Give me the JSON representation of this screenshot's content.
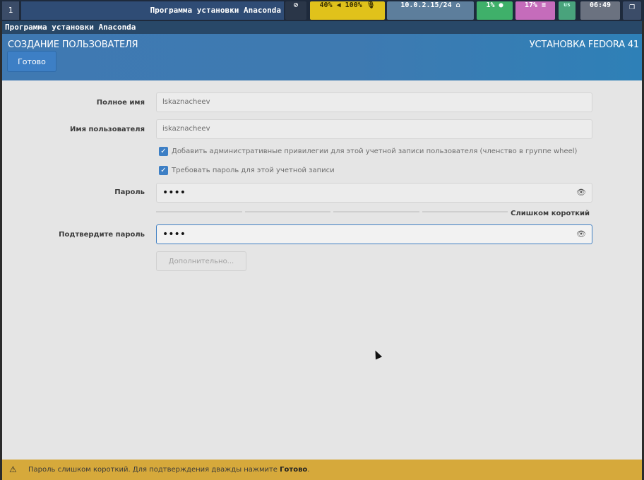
{
  "statusbar": {
    "workspace": "1",
    "window_title": "Программа установки Anaconda",
    "eye_icon": "eye-off-icon",
    "volume": "40% ◀ 100% 🎙",
    "network": "10.0.2.15/24 ⌂",
    "cpu": "1% ●",
    "memory": "17% ≡",
    "keyboard": "us",
    "clock": "06:49",
    "window_button": "❐"
  },
  "app": {
    "title": "Программа установки Anaconda"
  },
  "header": {
    "title": "СОЗДАНИЕ ПОЛЬЗОВАТЕЛЯ",
    "product": "УСТАНОВКА FEDORA 41",
    "done_label": "Готово"
  },
  "form": {
    "fullname_label": "Полное имя",
    "fullname_value": "lskaznacheev",
    "username_label": "Имя пользователя",
    "username_value": "iskaznacheev",
    "admin_checkbox_label": "Добавить административные привилегии для этой учетной записи пользователя (членство в группе wheel)",
    "admin_checked": true,
    "require_password_label": "Требовать пароль для этой учетной записи",
    "require_password_checked": true,
    "password_label": "Пароль",
    "password_value": "••••",
    "strength_label": "Слишком короткий",
    "confirm_label": "Подтвердите пароль",
    "confirm_value": "••••",
    "advanced_label": "Дополнительно..."
  },
  "warning": {
    "icon": "warning-icon",
    "text_prefix": "Пароль слишком короткий. Для подтверждения дважды нажмите",
    "text_bold": "Готово",
    "text_suffix": "."
  },
  "colors": {
    "header_blue": "#3f79b2",
    "accent": "#3d7fc5",
    "warning_bg": "#d6a93b"
  }
}
